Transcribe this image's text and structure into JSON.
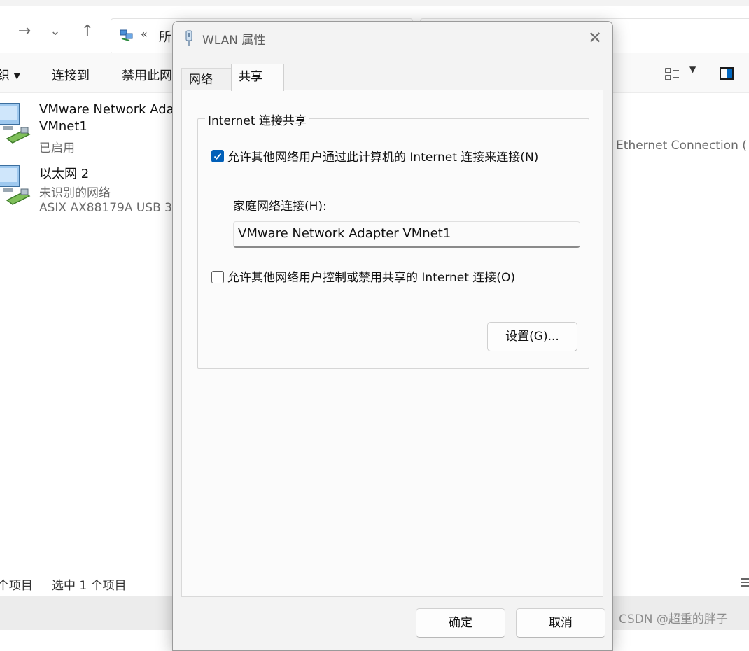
{
  "explorer": {
    "address": {
      "separator": "«",
      "text": "所"
    },
    "toolbar": {
      "organize_fragment": "织 ▾",
      "connect_to": "连接到",
      "disable": "禁用此网"
    },
    "items": [
      {
        "name": "VMware Network Ada",
        "name2": "VMnet1",
        "status": "已启用"
      },
      {
        "name": "以太网 2",
        "status": "未识别的网络",
        "device": "ASIX AX88179A USB 3"
      }
    ],
    "right_fragment": ") Ethernet Connection (",
    "status": {
      "count": "个项目",
      "selected": "选中 1 个项目"
    },
    "watermark": "CSDN @超重的胖子"
  },
  "dialog": {
    "title": "WLAN 属性",
    "tabs": [
      {
        "label": "网络"
      },
      {
        "label": "共享"
      }
    ],
    "active_tab": "共享",
    "group_title": "Internet 连接共享",
    "allow_connect": {
      "label": "允许其他网络用户通过此计算机的 Internet 连接来连接(N)",
      "checked": true
    },
    "home_network_label": "家庭网络连接(H):",
    "home_network_value": "VMware Network Adapter VMnet1",
    "allow_control": {
      "label": "允许其他网络用户控制或禁用共享的 Internet 连接(O)",
      "checked": false
    },
    "settings_button": "设置(G)...",
    "ok_button": "确定",
    "cancel_button": "取消"
  },
  "colors": {
    "accent": "#005fb8",
    "dialog_bg": "#f3f3f3"
  }
}
